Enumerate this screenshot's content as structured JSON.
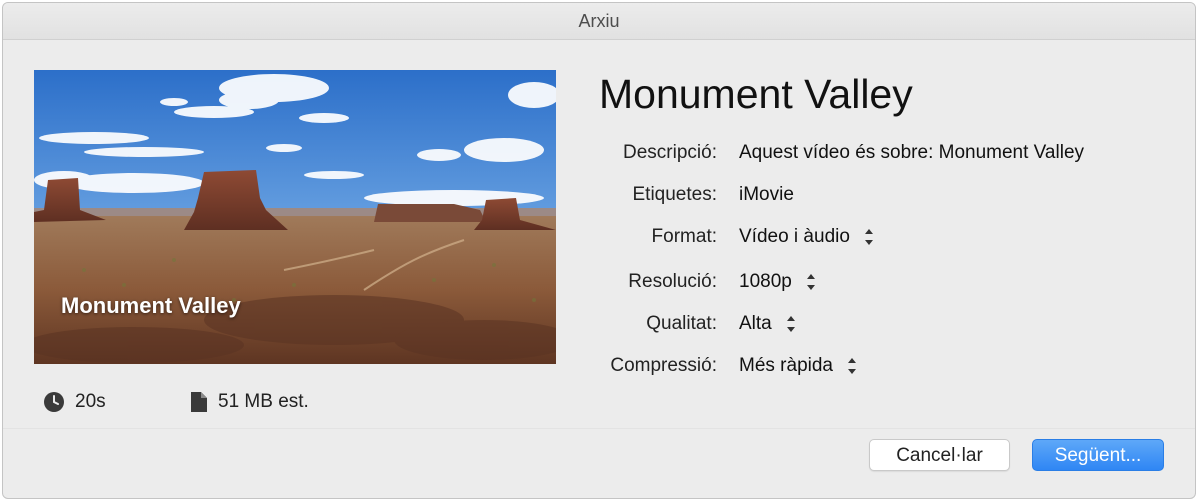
{
  "window": {
    "title": "Arxiu"
  },
  "preview": {
    "caption": "Monument Valley",
    "duration": "20s",
    "size_estimate": "51 MB est."
  },
  "details": {
    "title": "Monument Valley",
    "fields": [
      {
        "label": "Descripció:",
        "value": "Aquest vídeo és sobre: Monument Valley",
        "control": "text-field"
      },
      {
        "label": "Etiquetes:",
        "value": "iMovie",
        "control": "text-field"
      },
      {
        "label": "Format:",
        "value": "Vídeo i àudio",
        "control": "popup"
      },
      {
        "label": "Resolució:",
        "value": "1080p",
        "control": "popup"
      },
      {
        "label": "Qualitat:",
        "value": "Alta",
        "control": "popup"
      },
      {
        "label": "Compressió:",
        "value": "Més ràpida",
        "control": "popup"
      }
    ]
  },
  "buttons": {
    "cancel": "Cancel·lar",
    "next": "Següent..."
  },
  "colors": {
    "accent": "#2f86f4",
    "window_bg": "#ececec"
  }
}
